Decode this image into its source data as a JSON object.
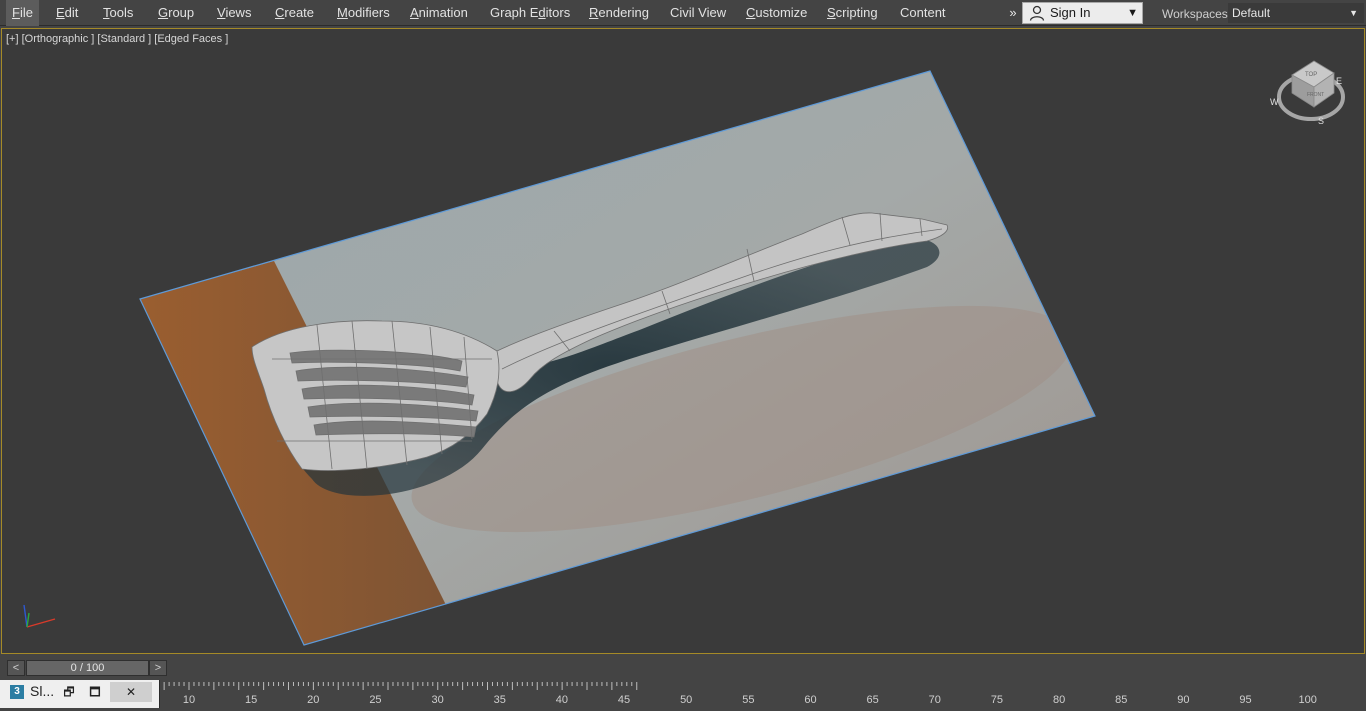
{
  "menubar": {
    "items": [
      {
        "label": "File",
        "mnemonic": "F",
        "rest": "ile",
        "id": "file"
      },
      {
        "label": "Edit",
        "mnemonic": "E",
        "rest": "dit",
        "id": "edit"
      },
      {
        "label": "Tools",
        "mnemonic": "T",
        "rest": "ools",
        "id": "tools"
      },
      {
        "label": "Group",
        "mnemonic": "G",
        "rest": "roup",
        "id": "group"
      },
      {
        "label": "Views",
        "mnemonic": "V",
        "rest": "iews",
        "id": "views"
      },
      {
        "label": "Create",
        "mnemonic": "C",
        "rest": "reate",
        "id": "create"
      },
      {
        "label": "Modifiers",
        "mnemonic": "M",
        "rest": "odifiers",
        "id": "modifiers"
      },
      {
        "label": "Animation",
        "mnemonic": "A",
        "rest": "nimation",
        "id": "animation"
      },
      {
        "label": "Graph Editors",
        "pre": "Graph E",
        "mnemonic": "d",
        "rest": "itors",
        "id": "graph-editors"
      },
      {
        "label": "Rendering",
        "mnemonic": "R",
        "rest": "endering",
        "id": "rendering"
      },
      {
        "label": "Civil View",
        "plain": "Civil View",
        "id": "civil-view"
      },
      {
        "label": "Customize",
        "mnemonic": "C",
        "rest": "ustomize",
        "id": "customize"
      },
      {
        "label": "Scripting",
        "mnemonic": "S",
        "rest": "cripting",
        "id": "scripting"
      },
      {
        "label": "Content",
        "plain": "Content",
        "id": "content"
      }
    ],
    "overflow_glyph": "»",
    "signin_label": "Sign In",
    "workspaces_label": "Workspaces:",
    "workspace_value": "Default"
  },
  "viewport": {
    "label": "[+] [Orthographic ] [Standard ] [Edged Faces ]",
    "viewcube": {
      "top_face": "TOP",
      "front_face": "FRONT",
      "compass": [
        "W",
        "S",
        "E"
      ]
    }
  },
  "timeline": {
    "prev": "<",
    "next": ">",
    "frame_display": "0 / 100",
    "ticks": [
      10,
      15,
      20,
      25,
      30,
      35,
      40,
      45,
      50,
      55,
      60,
      65,
      70,
      75,
      80,
      85,
      90,
      95,
      100
    ]
  },
  "taskbar_window": {
    "app_icon": "3",
    "title": "Sl...",
    "restore_glyph": "🗗",
    "maximize_glyph": "🗖",
    "close_glyph": "✕"
  },
  "colors": {
    "viewport_border": "#a58a27",
    "plane_edge": "#5e9ad8",
    "wood": "#8a5a33",
    "wall": "#8f9aa0"
  }
}
